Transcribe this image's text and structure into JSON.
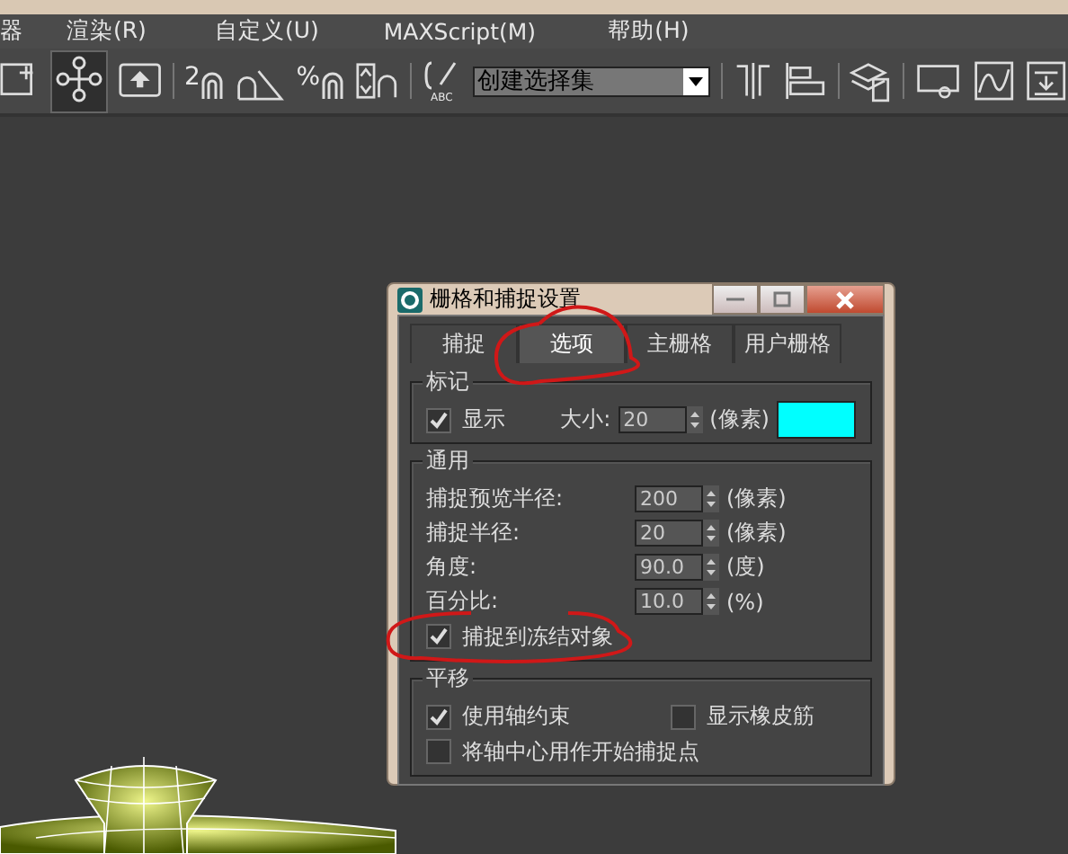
{
  "menu": [
    "器",
    "渲染(R)",
    "自定义(U)",
    "MAXScript(M)",
    "帮助(H)"
  ],
  "toolbar": {
    "snap_texts": [
      "2",
      "%"
    ],
    "abc_text": "ABC",
    "selection_set": "创建选择集"
  },
  "dialog": {
    "title": "栅格和捕捉设置",
    "tabs": [
      {
        "label": "捕捉",
        "selected": false
      },
      {
        "label": "选项",
        "selected": true
      },
      {
        "label": "主栅格",
        "selected": false
      },
      {
        "label": "用户栅格",
        "selected": false
      }
    ],
    "marker": {
      "title": "标记",
      "show": {
        "label": "显示",
        "checked": true
      },
      "size_label": "大小:",
      "size": "20",
      "unit": "(像素)",
      "color": "#00ffff"
    },
    "general": {
      "title": "通用",
      "rows": [
        {
          "label": "捕捉预览半径:",
          "value": "200",
          "unit": "(像素)"
        },
        {
          "label": "捕捉半径:",
          "value": "20",
          "unit": "(像素)"
        },
        {
          "label": "角度:",
          "value": "90.0",
          "unit": "(度)"
        },
        {
          "label": "百分比:",
          "value": "10.0",
          "unit": "(%)"
        }
      ],
      "freeze": {
        "label": "捕捉到冻结对象",
        "checked": true
      }
    },
    "translate": {
      "title": "平移",
      "options": [
        {
          "label": "使用轴约束",
          "checked": true
        },
        {
          "label": "显示橡皮筋",
          "checked": false
        },
        {
          "label": "将轴中心用作开始捕捉点",
          "checked": false
        }
      ]
    }
  },
  "annotations": [
    {
      "kind": "ellipse"
    },
    {
      "kind": "ellipse"
    }
  ]
}
